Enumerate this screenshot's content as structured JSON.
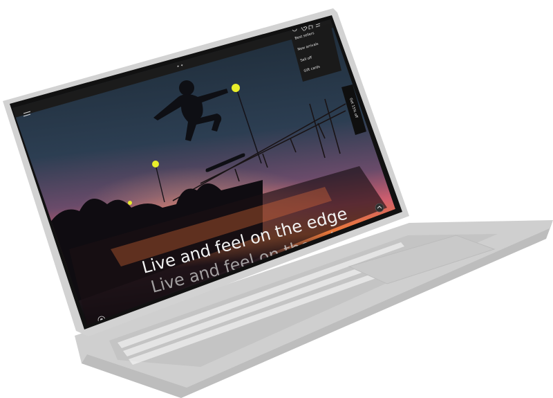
{
  "store": {
    "brand_logo": "skate-brand-logo",
    "menu_icon": "hamburger-menu-icon",
    "header_icons": [
      "account-icon",
      "wishlist-heart-icon",
      "cart-icon",
      "menu-icon"
    ]
  },
  "dropdown": {
    "items": [
      {
        "label": "Best sellers"
      },
      {
        "label": "New arrivals"
      },
      {
        "label": "Sell off"
      },
      {
        "label": "Gift cards"
      }
    ]
  },
  "side_tab": {
    "label": "Get 15% off"
  },
  "hero": {
    "headline": "Live and feel on the edge",
    "headline_reflection": "Live and feel on the edge",
    "scroll_button_icon": "chevron-up-icon",
    "corner_badge_icon": "skate-badge-icon"
  },
  "colors": {
    "laptop_shell": "#d2d2d2",
    "laptop_shadow": "#b9b9b9",
    "screen_bezel": "#111111",
    "header_bar": "#1b1b1b",
    "sky_top": "#17242f",
    "sunset_orange": "#e8703a",
    "sunset_pink": "#c9587a",
    "lamp_yellow": "#e9ee2a"
  }
}
